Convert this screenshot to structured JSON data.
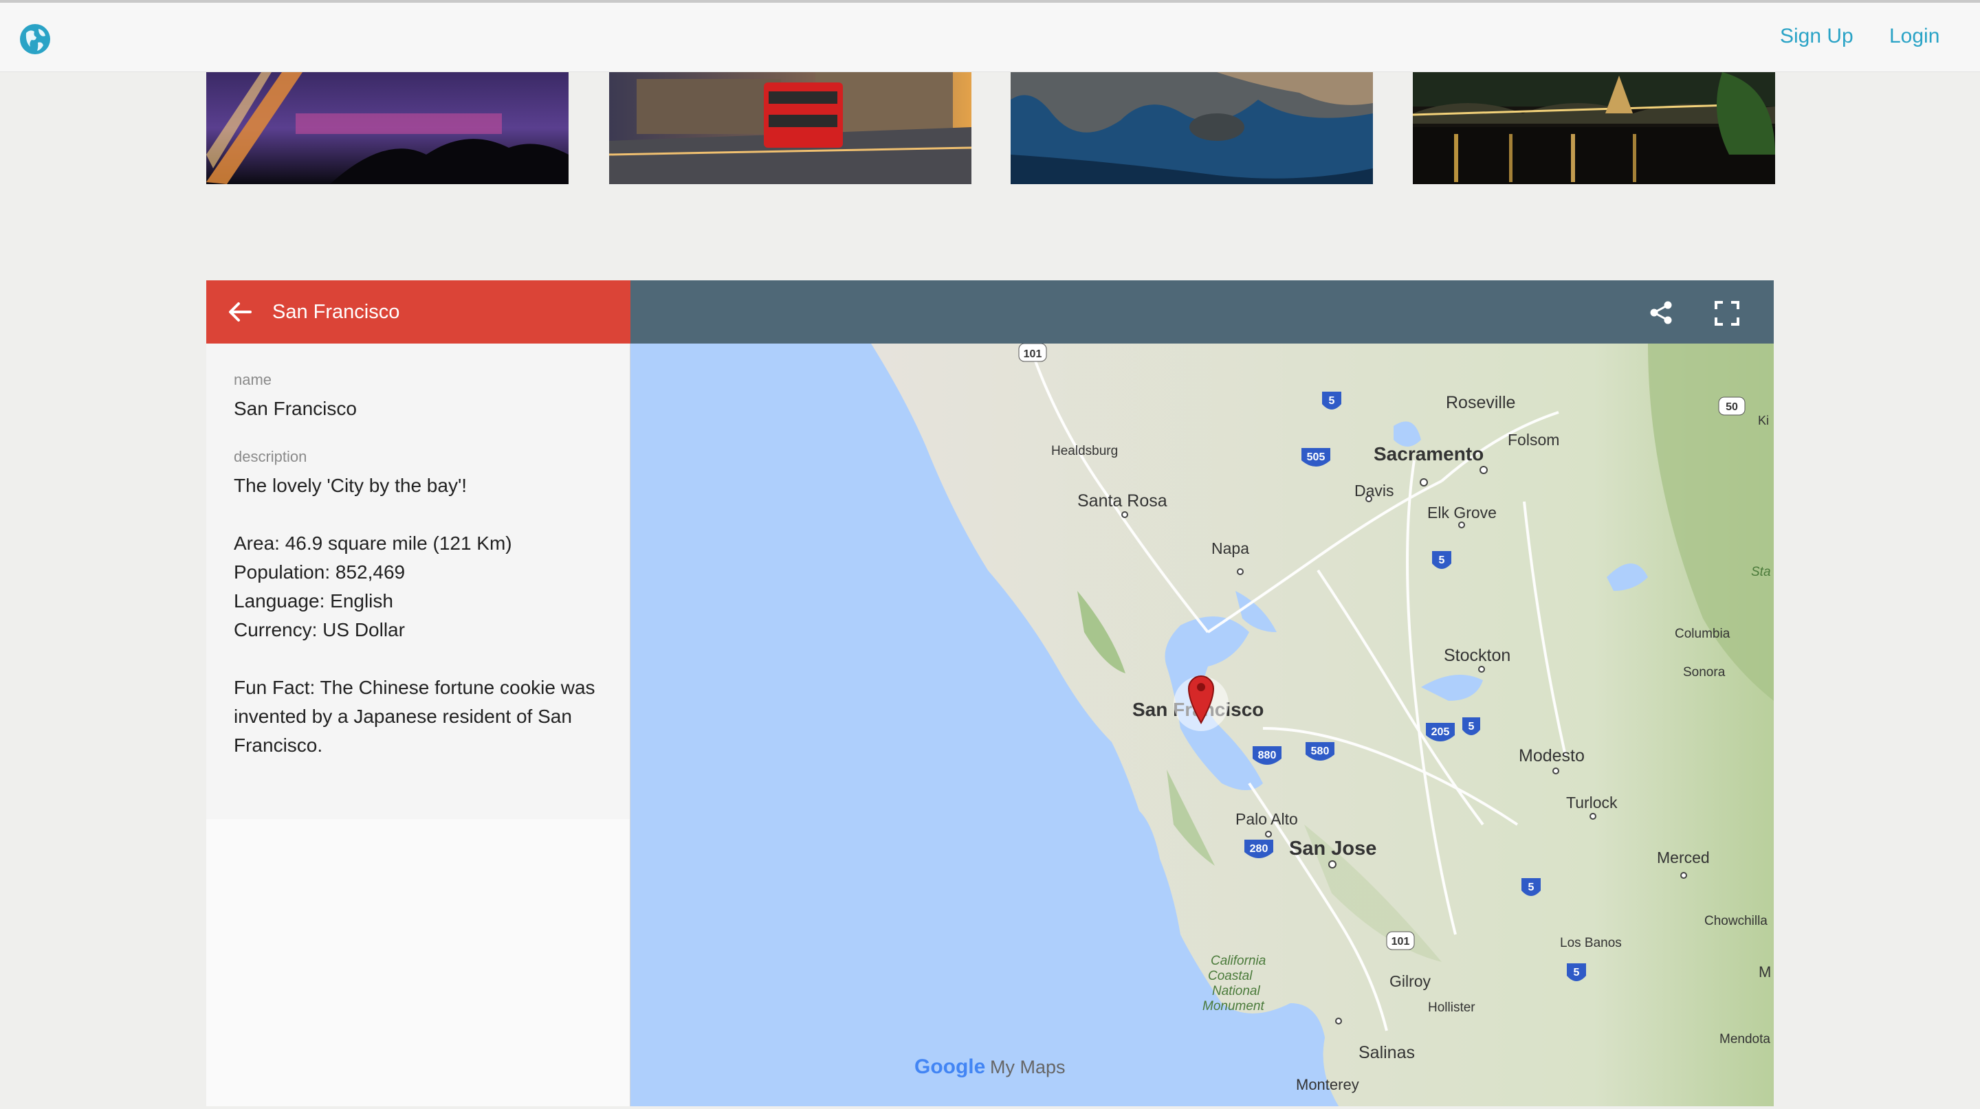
{
  "nav": {
    "signup": "Sign Up",
    "login": "Login"
  },
  "panel": {
    "title": "San Francisco",
    "name_label": "name",
    "name_value": "San Francisco",
    "description_label": "description",
    "description": {
      "tagline": "The lovely 'City by the bay'!",
      "area": "Area: 46.9 square mile (121 Km)",
      "population": "Population: 852,469",
      "language": "Language: English",
      "currency": "Currency: US Dollar",
      "fun_fact_1": "Fun Fact:  The Chinese fortune cookie was",
      "fun_fact_2": "invented by a Japanese resident of San",
      "fun_fact_3": "Francisco."
    }
  },
  "map": {
    "places": {
      "roseville": "Roseville",
      "folsom": "Folsom",
      "sacramento": "Sacramento",
      "davis": "Davis",
      "elk_grove": "Elk Grove",
      "healdsburg": "Healdsburg",
      "santa_rosa": "Santa Rosa",
      "napa": "Napa",
      "stockton": "Stockton",
      "columbia": "Columbia",
      "sonora": "Sonora",
      "san_francisco": "San Francisco",
      "modesto": "Modesto",
      "turlock": "Turlock",
      "palo_alto": "Palo Alto",
      "san_jose": "San Jose",
      "merced": "Merced",
      "chowchilla": "Chowchilla",
      "los_banos": "Los Banos",
      "gilroy": "Gilroy",
      "hollister": "Hollister",
      "california_coastal": "California Coastal National Monument",
      "salinas": "Salinas",
      "monterey": "Monterey",
      "mendota": "Mendota",
      "stanislaus": "Sta Natio",
      "kings": "Ki",
      "m": "M"
    },
    "highways": {
      "h101_top": "101",
      "h5_a": "5",
      "h505": "505",
      "h50": "50",
      "h5_b": "5",
      "h205": "205",
      "h5_c": "5",
      "h880": "880",
      "h580": "580",
      "h280": "280",
      "h5_d": "5",
      "h101_b": "101",
      "h5_e": "5"
    },
    "attribution_google": "Google",
    "attribution_mymaps": "My Maps"
  },
  "colors": {
    "header_red": "#db4437",
    "map_header": "#4f6877",
    "link": "#2aa3c6",
    "water": "#aecffc",
    "land": "#e8e6df"
  },
  "icons": [
    "globe-icon",
    "back-arrow-icon",
    "share-icon",
    "fullscreen-icon",
    "map-marker-icon"
  ]
}
